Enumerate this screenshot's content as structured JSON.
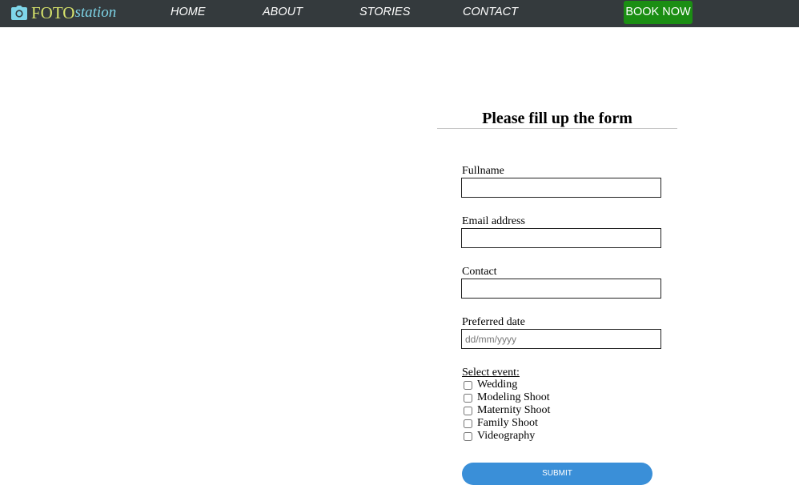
{
  "navbar": {
    "brand": {
      "icon": "camera-icon",
      "part1": "FOTO",
      "part2": "station",
      "color_part1": "#d7e36b",
      "color_part2": "#7fd6e9"
    },
    "links": [
      "HOME",
      "ABOUT",
      "STORIES",
      "CONTACT"
    ],
    "book_label": "BOOK NOW",
    "background": "#343a3d",
    "book_color": "#1b8e13"
  },
  "form": {
    "title": "Please fill up the form",
    "fields": [
      {
        "label": "Fullname",
        "value": "",
        "placeholder": ""
      },
      {
        "label": "Email address",
        "value": "",
        "placeholder": ""
      },
      {
        "label": "Contact",
        "value": "",
        "placeholder": ""
      },
      {
        "label": "Preferred date",
        "value": "",
        "placeholder": "dd/mm/yyyy"
      }
    ],
    "event_label": "Select event:",
    "events": [
      {
        "label": "Wedding",
        "checked": false
      },
      {
        "label": "Modeling Shoot",
        "checked": false
      },
      {
        "label": "Maternity Shoot",
        "checked": false
      },
      {
        "label": "Family Shoot",
        "checked": false
      },
      {
        "label": "Videography",
        "checked": false
      }
    ],
    "submit_label": "SUBMIT",
    "submit_color": "#3a8fd8"
  }
}
